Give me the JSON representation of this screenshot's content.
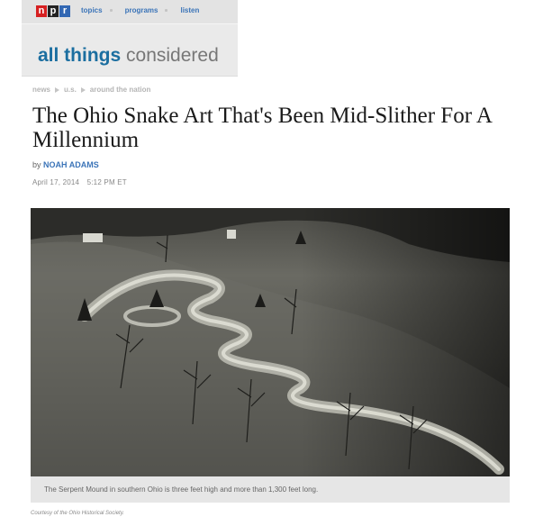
{
  "header": {
    "logo_letters": [
      "n",
      "p",
      "r"
    ],
    "logo_colors": [
      "#d62021",
      "#222222",
      "#3267b3"
    ],
    "nav": [
      "topics",
      "programs",
      "listen"
    ],
    "program_bold": "all things",
    "program_rest": "considered"
  },
  "breadcrumb": [
    "news",
    "u.s.",
    "around the nation"
  ],
  "article": {
    "headline": "The Ohio Snake Art That's Been Mid-Slither For A Millennium",
    "by_prefix": "by",
    "author": "NOAH ADAMS",
    "date": "April 17, 2014",
    "time": "5:12 PM ET"
  },
  "photo": {
    "caption": "The Serpent Mound in southern Ohio is three feet high and more than 1,300 feet long.",
    "credit": "Courtesy of the Ohio Historical Society."
  }
}
